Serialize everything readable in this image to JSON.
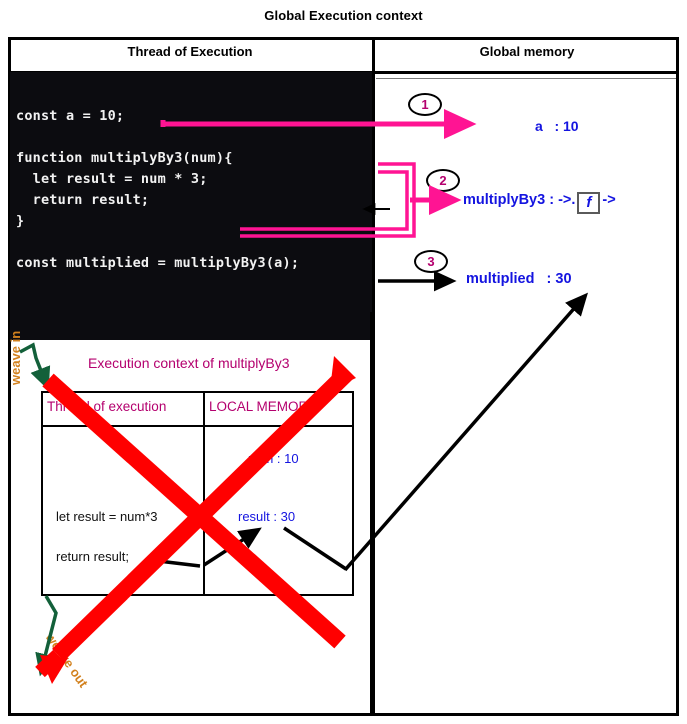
{
  "title": "Global Execution context",
  "columns": {
    "left_header": "Thread of Execution",
    "right_header": "Global memory"
  },
  "code": "const a = 10;\n\nfunction multiplyBy3(num){\n  let result = num * 3;\n  return result;\n}\n\nconst multiplied = multiplyBy3(a);",
  "global_memory": {
    "entry_a": "a   : 10",
    "entry_fn_label": "multiplyBy3 : ->.",
    "entry_fn_box": "f",
    "entry_fn_tail": "->",
    "entry_multiplied": "multiplied   : 30"
  },
  "steps": {
    "one": "1",
    "two": "2",
    "three": "3"
  },
  "execution_context": {
    "title": "Execution context of multiplyBy3",
    "thread_header": "Thread of execution",
    "memory_header": "LOCAL MEMORY",
    "thread_lines": [
      "let result = num*3",
      "return result;"
    ],
    "memory_lines": [
      "num : 10",
      "result : 30"
    ]
  },
  "annotations": {
    "weave_in": "weave in",
    "weave_out": "weave out"
  },
  "colors": {
    "code_bg": "#0c0c10",
    "code_fg": "#f2f2f2",
    "memory_blue": "#1414e0",
    "context_magenta": "#b4006e",
    "pink_arrow": "#ff1493",
    "weave_orange": "#d2811e",
    "weave_green": "#13603a",
    "strike_red": "#ff0000"
  }
}
